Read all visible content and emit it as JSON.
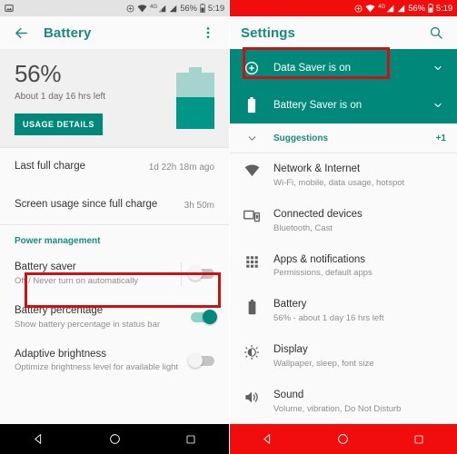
{
  "status_bar": {
    "left_icon": "image-icon",
    "data_saver_icon": "data-saver-icon",
    "wifi_icon": "wifi-icon",
    "network_type": "4G",
    "signal_icon": "signal-bars-icon",
    "battery_percent": "56%",
    "battery_icon": "battery-icon",
    "time": "5:19",
    "left_bg": "#e3e3e3",
    "right_bg": "#f20d0d"
  },
  "battery_screen": {
    "toolbar": {
      "back_icon": "back-arrow-icon",
      "title": "Battery",
      "overflow_icon": "more-vert-icon"
    },
    "summary": {
      "percent": "56%",
      "estimate": "About 1 day 16 hrs left",
      "usage_button": "USAGE DETAILS",
      "battery_fill_percent": 56,
      "fill_color": "#009688",
      "empty_color": "#a7d3cf"
    },
    "info_rows": [
      {
        "label": "Last full charge",
        "value": "1d 22h 18m ago"
      },
      {
        "label": "Screen usage since full charge",
        "value": "3h 50m"
      }
    ],
    "section_header": "Power management",
    "toggles": [
      {
        "title": "Battery saver",
        "subtitle": "Off / Never turn on automatically",
        "state": "off",
        "highlighted": true
      },
      {
        "title": "Battery percentage",
        "subtitle": "Show battery percentage in status bar",
        "state": "on",
        "highlighted": false
      },
      {
        "title": "Adaptive brightness",
        "subtitle": "Optimize brightness level for available light",
        "state": "off",
        "highlighted": false
      }
    ]
  },
  "settings_screen": {
    "toolbar": {
      "title": "Settings",
      "search_icon": "search-icon"
    },
    "banners": [
      {
        "icon": "data-saver-icon",
        "label": "Data Saver is on",
        "chevron": "chevron-down-icon",
        "highlighted": true
      },
      {
        "icon": "battery-icon",
        "label": "Battery Saver is on",
        "chevron": "chevron-down-icon",
        "highlighted": false
      }
    ],
    "suggestions": {
      "chevron": "chevron-down-icon",
      "label": "Suggestions",
      "count": "+1"
    },
    "items": [
      {
        "icon": "wifi-icon",
        "title": "Network & Internet",
        "subtitle": "Wi-Fi, mobile, data usage, hotspot"
      },
      {
        "icon": "devices-icon",
        "title": "Connected devices",
        "subtitle": "Bluetooth, Cast"
      },
      {
        "icon": "apps-grid-icon",
        "title": "Apps & notifications",
        "subtitle": "Permissions, default apps"
      },
      {
        "icon": "battery-icon",
        "title": "Battery",
        "subtitle": "56% - about 1 day 16 hrs left"
      },
      {
        "icon": "brightness-icon",
        "title": "Display",
        "subtitle": "Wallpaper, sleep, font size"
      },
      {
        "icon": "volume-icon",
        "title": "Sound",
        "subtitle": "Volume, vibration, Do Not Disturb"
      }
    ]
  },
  "nav_bar": {
    "back_icon": "nav-back-triangle-icon",
    "home_icon": "nav-home-circle-icon",
    "recents_icon": "nav-recents-square-icon",
    "left_bg": "#000000",
    "right_bg": "#f20d0d"
  },
  "highlight_color": "#cc1212"
}
